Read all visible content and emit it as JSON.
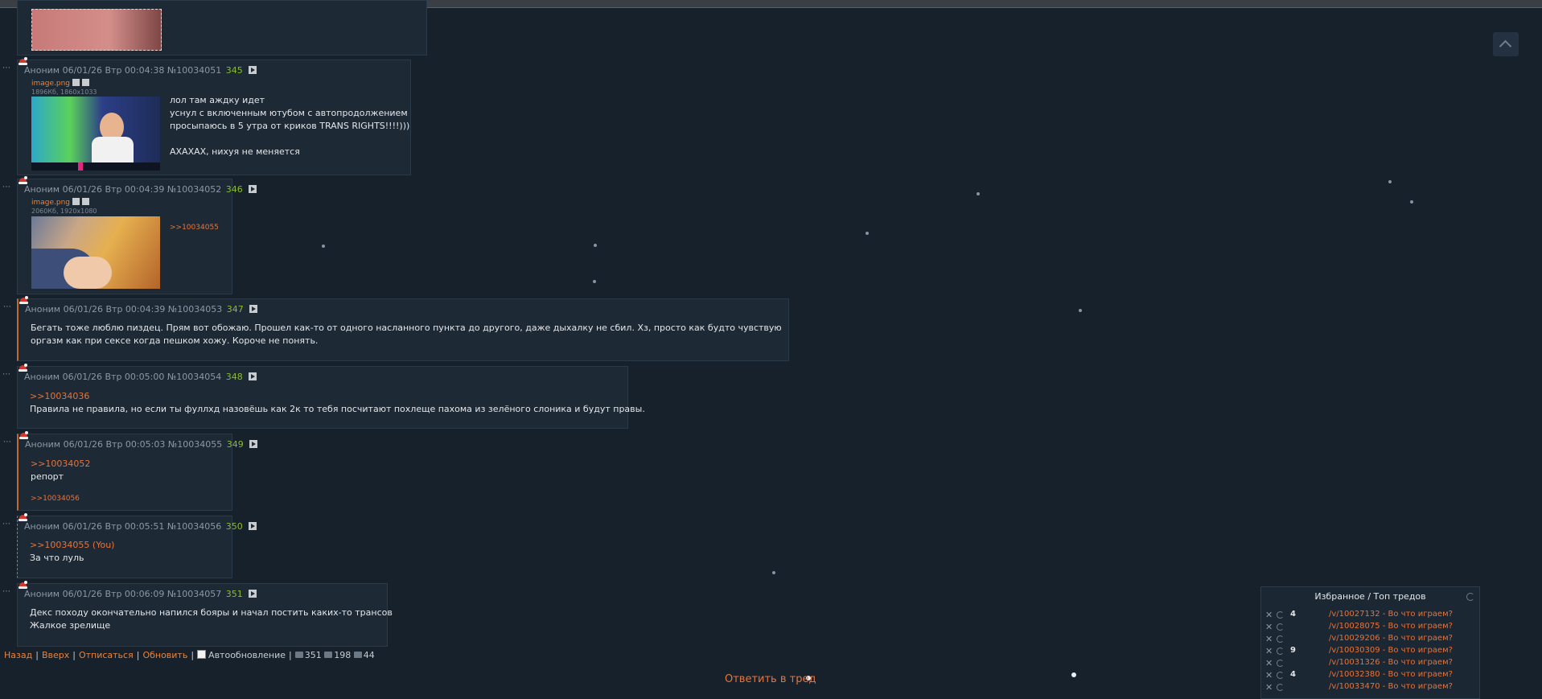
{
  "posts": [
    {
      "id": "p345",
      "author": "Аноним",
      "date": "06/01/26 Втр 00:04:38",
      "no": "№10034051",
      "count": "345",
      "file": {
        "name": "image.png",
        "meta": "1896Кб, 1860x1033"
      },
      "lines": [
        "лол там аждку идет",
        "уснул с включенным ютубом с автопродолжением",
        "просыпаюсь в 5 утра от криков TRANS RIGHTS!!!!)))",
        "",
        "АХАХАХ, нихуя не меняется"
      ]
    },
    {
      "id": "p346",
      "author": "Аноним",
      "date": "06/01/26 Втр 00:04:39",
      "no": "№10034052",
      "count": "346",
      "file": {
        "name": "image.png",
        "meta": "2060Кб, 1920x1080"
      },
      "backref": ">>10034055"
    },
    {
      "id": "p347",
      "author": "Аноним",
      "date": "06/01/26 Втр 00:04:39",
      "no": "№10034053",
      "count": "347",
      "lines": [
        "Бегать тоже люблю пиздец. Прям вот обожаю. Прошел как-то от одного насланного пункта до другого, даже дыхалку не сбил. Хз, просто как будто чувствую",
        "оргазм как при сексе когда пешком хожу. Короче не понять."
      ]
    },
    {
      "id": "p348",
      "author": "Аноним",
      "date": "06/01/26 Втр 00:05:00",
      "no": "№10034054",
      "count": "348",
      "reply": ">>10034036",
      "lines": [
        "Правила не правила, но если ты фуллхд назовёшь как 2к то тебя посчитают похлеще пахома из зелёного слоника и будут правы."
      ]
    },
    {
      "id": "p349",
      "author": "Аноним",
      "date": "06/01/26 Втр 00:05:03",
      "no": "№10034055",
      "count": "349",
      "reply": ">>10034052",
      "lines": [
        "репорт"
      ],
      "backref": ">>10034056"
    },
    {
      "id": "p350",
      "author": "Аноним",
      "date": "06/01/26 Втр 00:05:51",
      "no": "№10034056",
      "count": "350",
      "reply": ">>10034055 (You)",
      "lines": [
        "За что луль"
      ]
    },
    {
      "id": "p351",
      "author": "Аноним",
      "date": "06/01/26 Втр 00:06:09",
      "no": "№10034057",
      "count": "351",
      "lines": [
        "Декс походу окончательно напился бояры и начал постить каких-то трансов",
        "Жалкое зрелище"
      ]
    }
  ],
  "bottom": {
    "back": "Назад",
    "up": "Вверх",
    "unsubscribe": "Отписаться",
    "refresh": "Обновить",
    "autorefresh": "Автообновление",
    "posts": "351",
    "files": "198",
    "users": "44"
  },
  "reply_button": "Ответить в тред",
  "favorites": {
    "title": "Избранное / Топ тредов",
    "rows": [
      {
        "count": "4",
        "link": "/v/10027132 - Во что играем?"
      },
      {
        "count": "",
        "link": "/v/10028075 - Во что играем?"
      },
      {
        "count": "",
        "link": "/v/10029206 - Во что играем?"
      },
      {
        "count": "9",
        "link": "/v/10030309 - Во что играем?"
      },
      {
        "count": "",
        "link": "/v/10031326 - Во что играем?"
      },
      {
        "count": "4",
        "link": "/v/10032380 - Во что играем?"
      },
      {
        "count": "",
        "link": "/v/10033470 - Во что играем?"
      }
    ]
  }
}
